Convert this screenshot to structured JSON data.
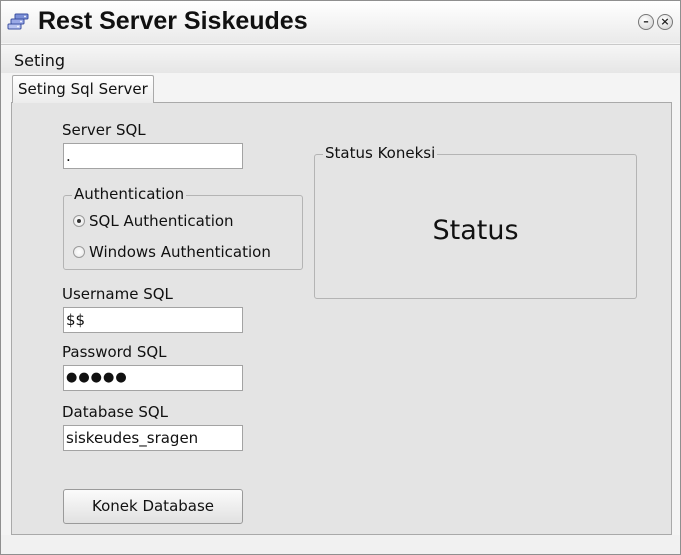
{
  "window": {
    "title": "Rest Server Siskeudes"
  },
  "menu": {
    "items": [
      "Seting"
    ]
  },
  "tabs": [
    {
      "label": "Seting Sql Server"
    }
  ],
  "form": {
    "server_label": "Server SQL",
    "server_value": ".",
    "auth_group_label": "Authentication",
    "auth_options": [
      {
        "label": "SQL Authentication",
        "checked": true
      },
      {
        "label": "Windows Authentication",
        "checked": false
      }
    ],
    "username_label": "Username SQL",
    "username_value": "$$",
    "password_label": "Password SQL",
    "password_value": "●●●●●",
    "database_label": "Database SQL",
    "database_value": "siskeudes_sragen",
    "connect_button": "Konek Database"
  },
  "status": {
    "group_label": "Status Koneksi",
    "text": "Status"
  },
  "icons": {
    "app": "network-server-icon",
    "minimize": "minimize-icon",
    "close": "close-icon"
  }
}
